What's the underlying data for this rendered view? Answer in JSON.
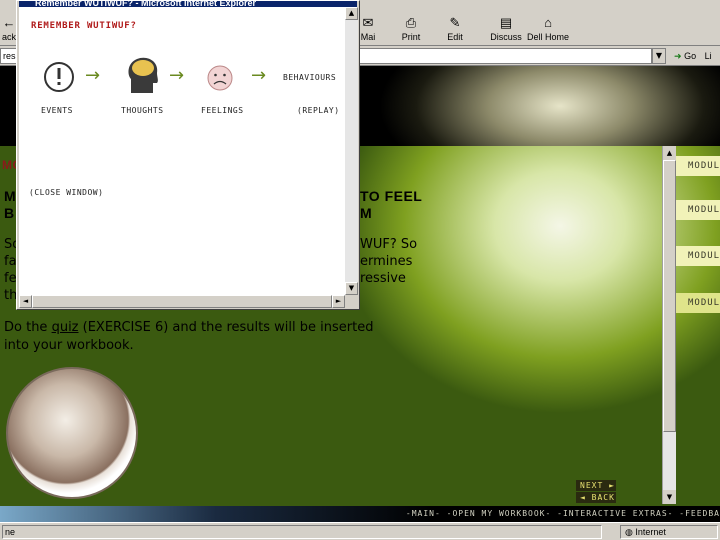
{
  "browser": {
    "toolbar": {
      "back_label": "ack",
      "mail_label": "Mai",
      "print_label": "Print",
      "edit_label": "Edit",
      "discuss_label": "Discuss",
      "dellhome_label": "Dell Home"
    },
    "address": {
      "label": "ress",
      "go_label": "Go",
      "links_label": "Li"
    },
    "status": {
      "left_text": "ne",
      "zone_text": "Internet"
    }
  },
  "popup": {
    "window_title": "Remember WUTIWUF? - Microsoft Internet Explorer",
    "heading": "REMEMBER WUTIWUF?",
    "steps": [
      {
        "label": "EVENTS"
      },
      {
        "label": "THOUGHTS"
      },
      {
        "label": "FEELINGS"
      },
      {
        "label": "BEHAVIOURS"
      }
    ],
    "replay_label": "(REPLAY)",
    "close_label": "(CLOSE WINDOW)"
  },
  "page": {
    "section_fragment": "MC",
    "heading_fragment_right_1": "TO FEEL",
    "heading_fragment_right_2": "M",
    "heading_left_1": "M",
    "heading_left_2": "B",
    "para_right_1": "WUF? So",
    "para_right_2": "ermines",
    "para_right_3": "ressive",
    "para_left_1": "So",
    "para_left_2": "fa",
    "para_left_3": "fe",
    "para_left_4": "th",
    "quiz_before": "Do the ",
    "quiz_link": "quiz",
    "quiz_after": " (EXERCISE 6) and the results will be inserted",
    "quiz_line2": "into your workbook.",
    "modules": [
      "MODUL",
      "MODUL",
      "MODUL",
      "MODUL"
    ],
    "next_label": "NEXT ►",
    "back_label": "◄ BACK",
    "footer_links": "-MAIN- -OPEN MY WORKBOOK- -INTERACTIVE EXTRAS- -FEEDBA"
  }
}
